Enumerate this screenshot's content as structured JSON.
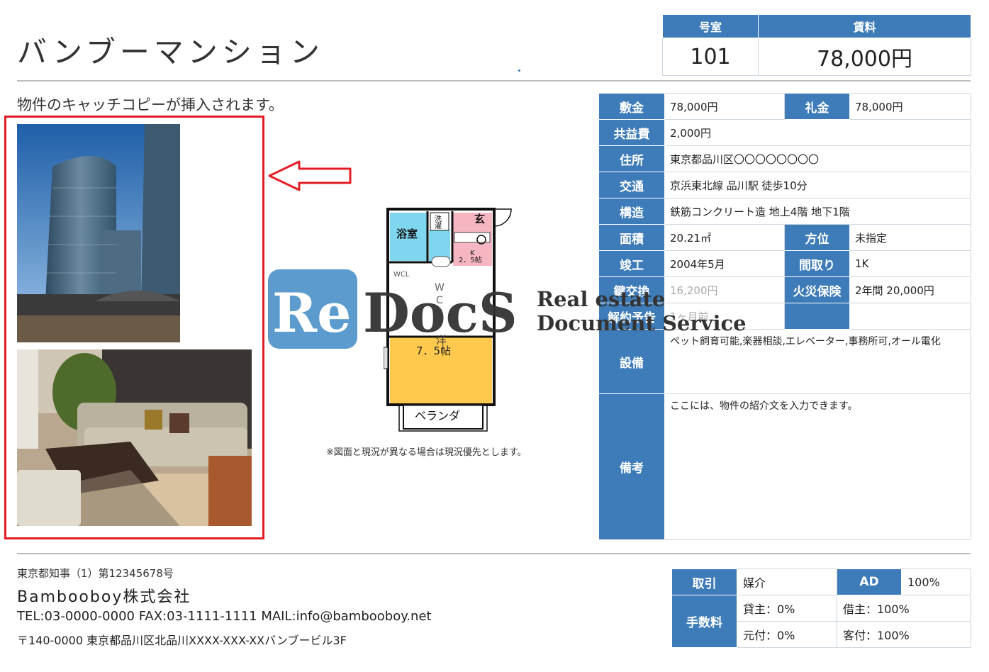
{
  "property": {
    "name": "バンブーマンション",
    "catch_copy": "物件のキャッチコピーが挿入されます。"
  },
  "top_table": {
    "room_label": "号室",
    "rent_label": "賃料",
    "room_value": "101",
    "rent_value": "78,000円"
  },
  "details": {
    "deposit_label": "敷金",
    "deposit_value": "78,000円",
    "key_money_label": "礼金",
    "key_money_value": "78,000円",
    "common_fee_label": "共益費",
    "common_fee_value": "2,000円",
    "address_label": "住所",
    "address_value": "東京都品川区〇〇〇〇〇〇〇〇",
    "transport_label": "交通",
    "transport_value": "京浜東北線 品川駅 徒歩10分",
    "structure_label": "構造",
    "structure_value": "鉄筋コンクリート造 地上4階 地下1階",
    "area_label": "面積",
    "area_value": "20.21㎡",
    "direction_label": "方位",
    "direction_value": "未指定",
    "built_label": "竣工",
    "built_value": "2004年5月",
    "layout_label": "間取り",
    "layout_value": "1K",
    "renewal_label": "鍵交換",
    "renewal_value": "16,200円",
    "insurance_label": "火災保険",
    "insurance_value": "2年間 20,000円",
    "notice_label": "解約予告",
    "notice_value": "1ヶ月前",
    "facilities_label": "設備",
    "facilities_value": "ペット飼育可能,楽器相談,エレベーター,事務所可,オール電化",
    "remarks_label": "備考",
    "remarks_value": "ここには、物件の紹介文を入力できます。"
  },
  "floor_plan": {
    "bath": "浴室",
    "laundry_1": "洗",
    "laundry_2": "濯",
    "entrance": "玄",
    "kitchen_1": "K",
    "kitchen_2": "2．5帖",
    "wcl": "WCL",
    "wc_1": "W",
    "wc_2": "C",
    "western_1": "洋",
    "western_2": "7．5帖",
    "balcony": "ベランダ",
    "note": "※図面と現況が異なる場合は現況優先とします。"
  },
  "watermark": {
    "logo_re": "Re",
    "logo_docs": "DocS",
    "line1": "Real estate",
    "line2": "Document Service"
  },
  "footer": {
    "license": "東京都知事（1）第12345678号",
    "company": "Bambooboy株式会社",
    "contact": "TEL:03-0000-0000 FAX:03-1111-1111 MAIL:info@bambooboy.net",
    "address": "〒140-0000 東京都品川区北品川XXXX-XXX-XXバンブービル3F"
  },
  "fee_table": {
    "deal_label": "取引",
    "deal_value": "媒介",
    "ad_label": "AD",
    "ad_value": "100%",
    "commission_label": "手数料",
    "tenant_label": "貸主：0%",
    "borrower_label": "借主：100%",
    "origin_label": "元付：0%",
    "guest_label": "客付：100%"
  },
  "colors": {
    "header_blue": "#3e7cb9",
    "highlight_red": "#e31c25",
    "floor_yellow": "#ffc94d",
    "floor_cyan": "#7fd6ef",
    "floor_pink": "#f6b6c1"
  }
}
